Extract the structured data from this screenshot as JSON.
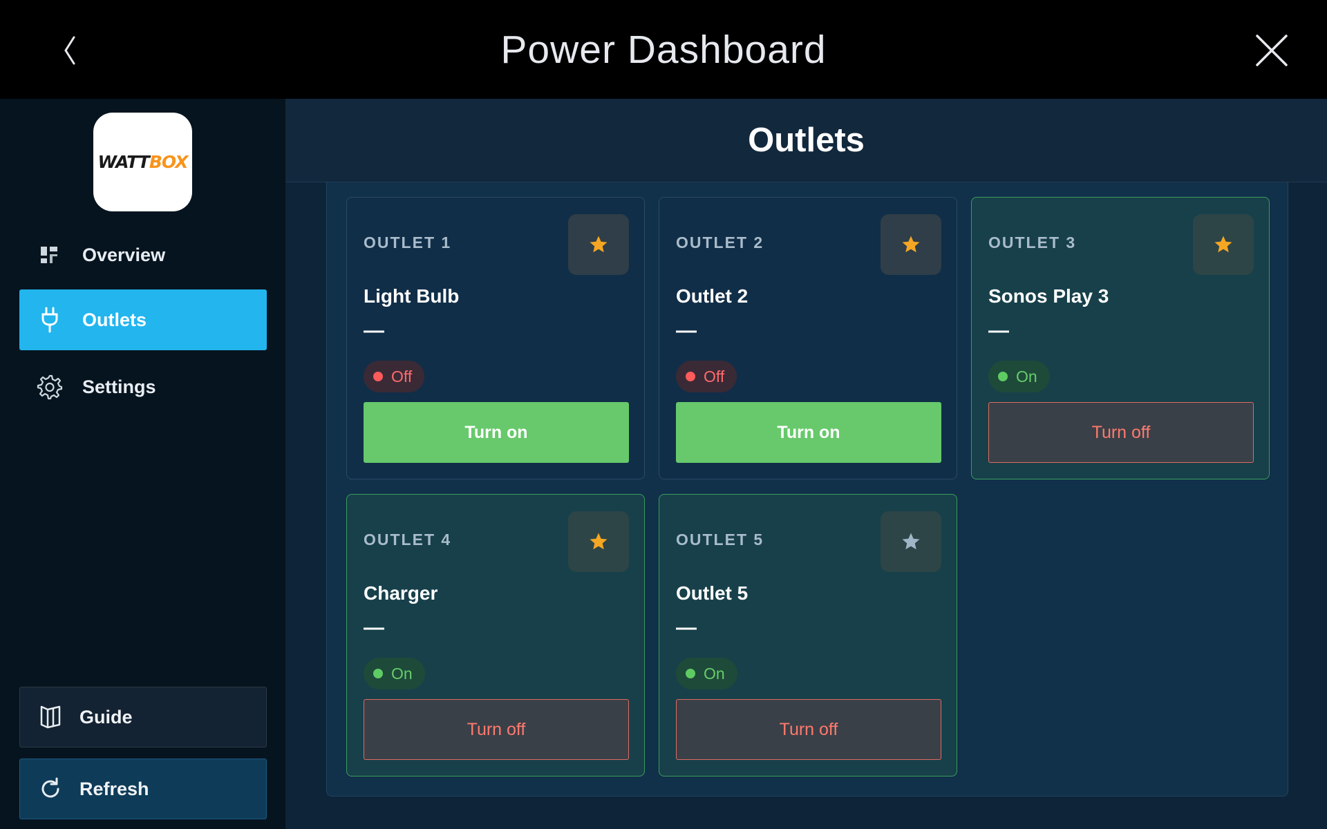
{
  "window": {
    "title": "Power Dashboard"
  },
  "sidebar": {
    "logo": {
      "part1": "WATT",
      "part2": "BOX"
    },
    "items": [
      {
        "label": "Overview",
        "icon": "dashboard-icon",
        "active": false
      },
      {
        "label": "Outlets",
        "icon": "plug-icon",
        "active": true
      },
      {
        "label": "Settings",
        "icon": "gear-icon",
        "active": false
      }
    ],
    "guide_label": "Guide",
    "refresh_label": "Refresh"
  },
  "main": {
    "title": "Outlets",
    "outlets": [
      {
        "index": "OUTLET 1",
        "name": "Light Bulb",
        "power": "—",
        "status": "Off",
        "action": "Turn on",
        "favorite": true
      },
      {
        "index": "OUTLET 2",
        "name": "Outlet 2",
        "power": "—",
        "status": "Off",
        "action": "Turn on",
        "favorite": true
      },
      {
        "index": "OUTLET 3",
        "name": "Sonos Play 3",
        "power": "—",
        "status": "On",
        "action": "Turn off",
        "favorite": true
      },
      {
        "index": "OUTLET 4",
        "name": "Charger",
        "power": "—",
        "status": "On",
        "action": "Turn off",
        "favorite": true
      },
      {
        "index": "OUTLET 5",
        "name": "Outlet 5",
        "power": "—",
        "status": "On",
        "action": "Turn off",
        "favorite": false
      }
    ]
  },
  "colors": {
    "accent": "#22b5ee",
    "on_green": "#67c96b",
    "off_red": "#ff5b5b",
    "star_active": "#f5a623",
    "star_inactive": "#9fb6c6"
  }
}
